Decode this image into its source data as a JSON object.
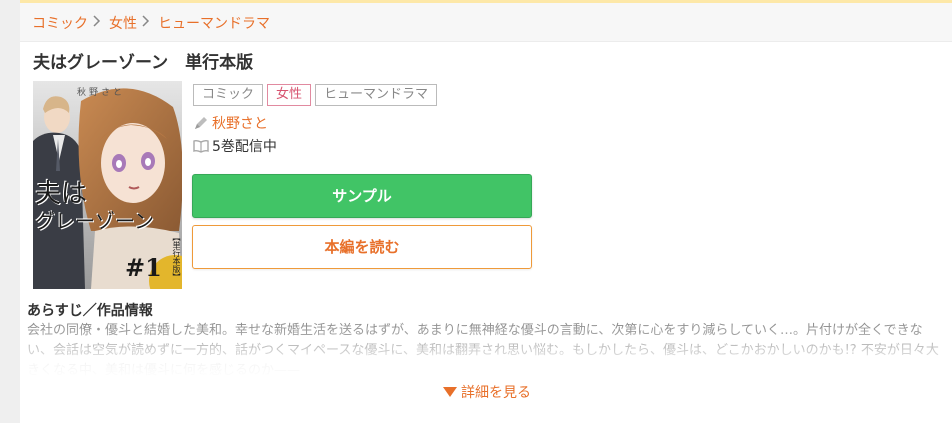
{
  "breadcrumb": [
    "コミック",
    "女性",
    "ヒューマンドラマ"
  ],
  "title": "夫はグレーゾーン　単行本版",
  "cover": {
    "author_text": "秋野さと",
    "title_line1": "夫は",
    "title_line2": "グレーゾーン",
    "edition": "【単行本版】",
    "volume": "#1"
  },
  "tags": [
    "コミック",
    "女性",
    "ヒューマンドラマ"
  ],
  "author": {
    "name": "秋野さと",
    "icon": "pen-icon"
  },
  "volumes": {
    "text": "5巻配信中",
    "icon": "book-icon"
  },
  "buttons": {
    "sample": "サンプル",
    "read": "本編を読む"
  },
  "synopsis": {
    "heading": "あらすじ／作品情報",
    "text": "会社の同僚・優斗と結婚した美和。幸せな新婚生活を送るはずが、あまりに無神経な優斗の言動に、次第に心をすり減らしていく…。片付けが全くできない、会話は空気が読めずに一方的、話がつくマイペースな優斗に、美和は翻弄され思い悩む。もしかしたら、優斗は、どこかおかしいのかも!? 不安が日々大きくなる中、美和は優斗に何を感じるのか——"
  },
  "more_link": "詳細を見る",
  "colors": {
    "accent": "#e8702a",
    "green": "#41c466",
    "pink": "#d7536f"
  }
}
